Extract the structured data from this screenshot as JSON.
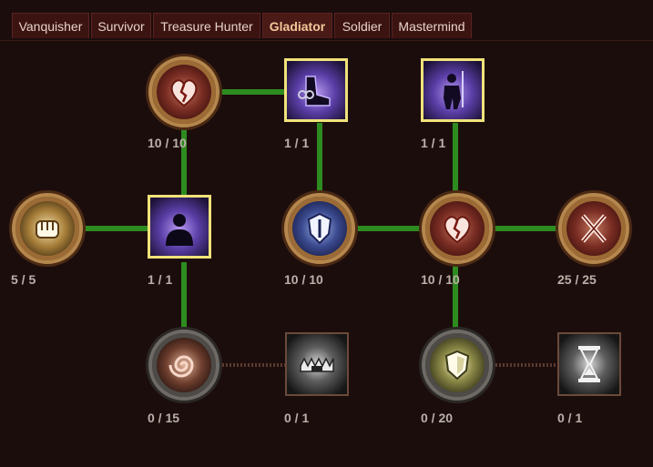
{
  "tabs": [
    {
      "label": "Vanquisher"
    },
    {
      "label": "Survivor"
    },
    {
      "label": "Treasure Hunter"
    },
    {
      "label": "Gladiator"
    },
    {
      "label": "Soldier"
    },
    {
      "label": "Mastermind"
    }
  ],
  "active_tab": "Gladiator",
  "nodes": [
    {
      "id": "heart-top",
      "icon": "broken-heart-icon",
      "rank": "10 / 10"
    },
    {
      "id": "chained-boot",
      "icon": "chained-boot-icon",
      "rank": "1 / 1"
    },
    {
      "id": "spear-warrior",
      "icon": "spear-warrior-icon",
      "rank": "1 / 1"
    },
    {
      "id": "fist",
      "icon": "fist-icon",
      "rank": "5 / 5"
    },
    {
      "id": "shadow-figure",
      "icon": "shadow-figure-icon",
      "rank": "1 / 1"
    },
    {
      "id": "blue-shield",
      "icon": "shield-emblem-icon",
      "rank": "10 / 10"
    },
    {
      "id": "heart-mid",
      "icon": "broken-heart-icon",
      "rank": "10 / 10"
    },
    {
      "id": "crossed-blades",
      "icon": "crossed-blades-icon",
      "rank": "25 / 25"
    },
    {
      "id": "swirl",
      "icon": "swirl-icon",
      "rank": "0 / 15"
    },
    {
      "id": "bear-trap",
      "icon": "bear-trap-icon",
      "rank": "0 / 1"
    },
    {
      "id": "yellow-shield",
      "icon": "shield-icon",
      "rank": "0 / 20"
    },
    {
      "id": "hourglass",
      "icon": "hourglass-icon",
      "rank": "0 / 1"
    }
  ],
  "colors": {
    "active_link": "#2e8b1f",
    "inactive_link": "#5b3a2c",
    "background": "#1c0d0d",
    "tab_bg": "#3b1412",
    "active_tab_text": "#f3c79a"
  }
}
